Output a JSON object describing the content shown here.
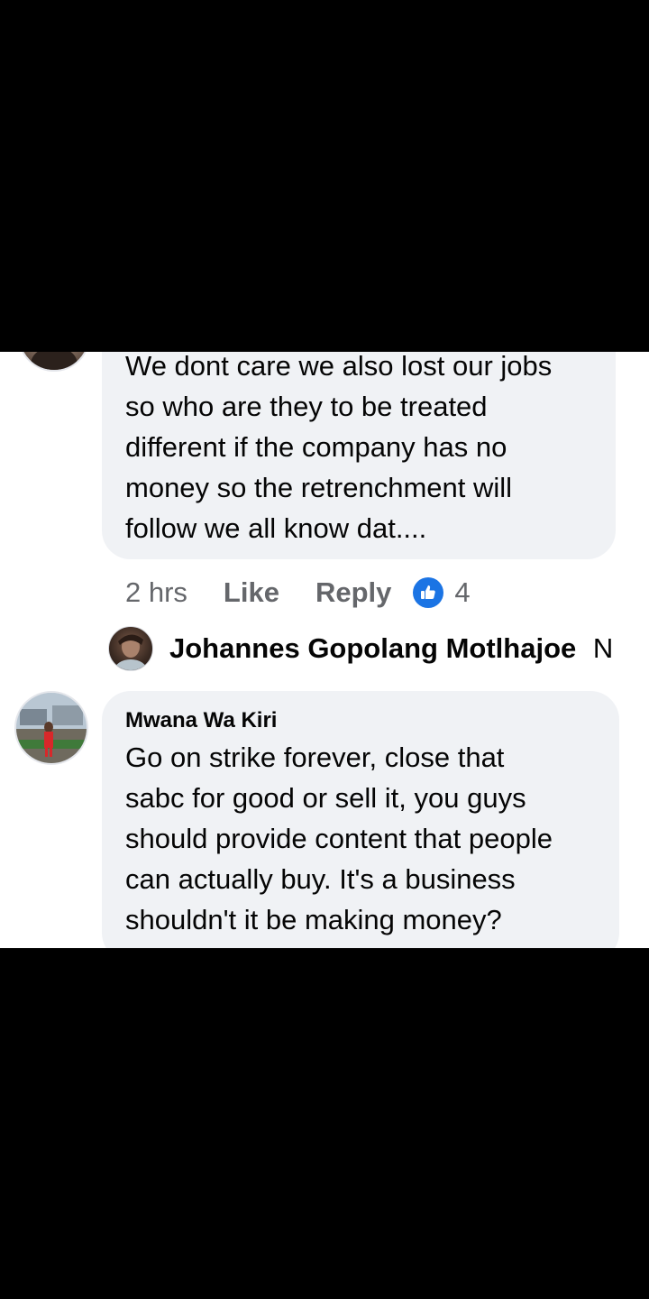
{
  "comment_1": {
    "text": "We dont care we also lost our jobs\nso who are they to be treated\ndifferent if the company has no\nmoney so the retrenchment will\nfollow we all know dat....",
    "time": "2 hrs",
    "like_label": "Like",
    "reply_label": "Reply",
    "reaction_icon": "thumbs-up-icon",
    "reaction_count": "4"
  },
  "reply_preview": {
    "author": "Johannes Gopolang Motlhajoe",
    "snippet": "N"
  },
  "comment_2": {
    "author": "Mwana Wa Kiri",
    "text": "Go on strike forever, close that\nsabc for good or sell it, you guys\nshould provide content that people\ncan actually buy. It's a business\nshouldn't it be making money?"
  },
  "colors": {
    "bubble": "#f0f2f5",
    "text": "#050505",
    "secondary_text": "#65676b",
    "like_blue": "#1b74e4",
    "screen_black": "#000000"
  }
}
